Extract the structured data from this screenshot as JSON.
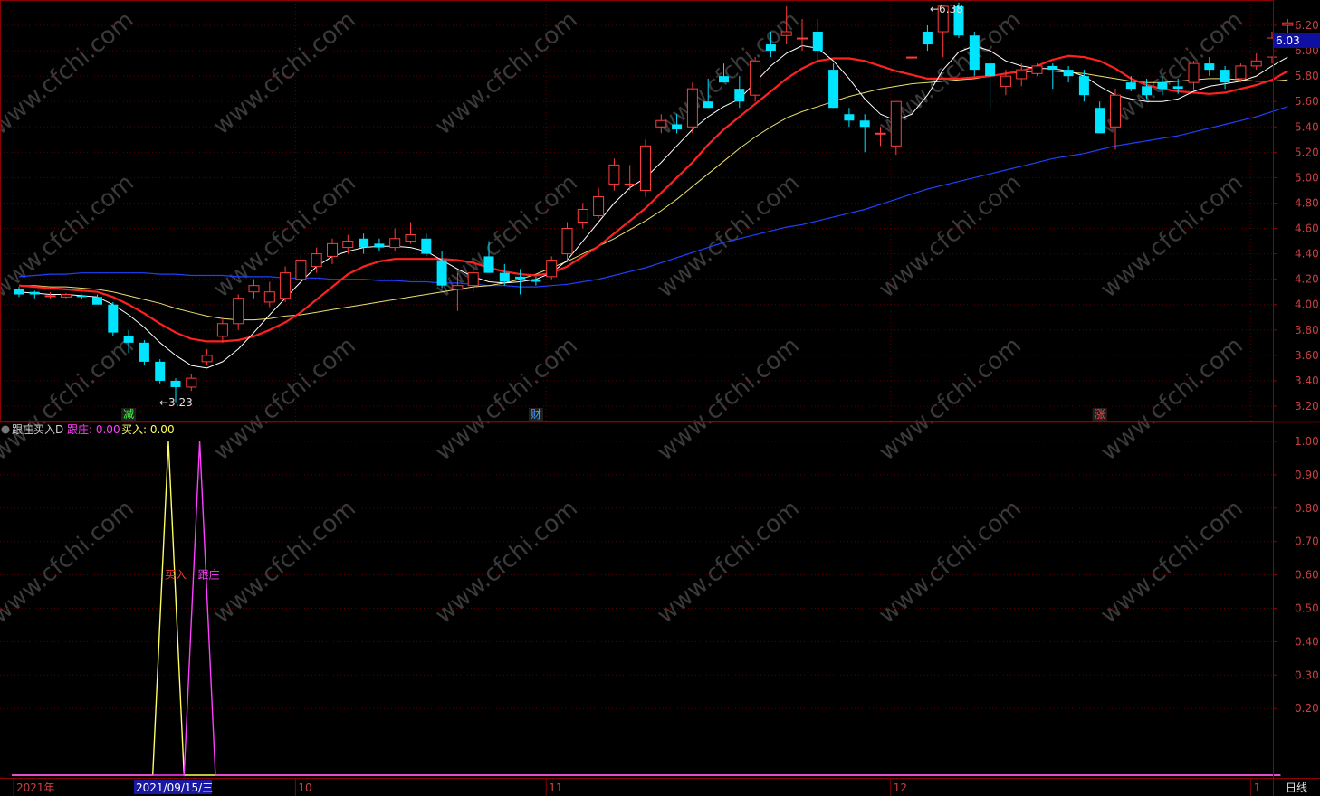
{
  "colors": {
    "background": "#000000",
    "frame": "#8b0000",
    "grid": "#5a0000",
    "axis_text": "#c84040",
    "up": "#ff3c3c",
    "down": "#00e5ff",
    "ma_white": "#ffffff",
    "ma_red": "#ff2020",
    "ma_yellow": "#e8e070",
    "ma_blue": "#2040ff",
    "follow_line": "#ff40ff",
    "buy_line": "#ffff60"
  },
  "watermark": "www.cfchi.com",
  "price_panel": {
    "yticks": [
      "6.20",
      "6.00",
      "5.80",
      "5.60",
      "5.40",
      "5.20",
      "5.00",
      "4.80",
      "4.60",
      "4.40",
      "4.20",
      "4.00",
      "3.80",
      "3.60",
      "3.40",
      "3.20"
    ],
    "current_price": "6.03",
    "high_label": "6.38",
    "low_label": "3.23",
    "high_arrow": "←6.38",
    "low_arrow": "←3.23",
    "markers": [
      {
        "text": "减",
        "color": "#40ff40",
        "bar": 7
      },
      {
        "text": "财",
        "color": "#40a0ff",
        "bar": 33
      },
      {
        "text": "涨",
        "color": "#ff4040",
        "bar": 69
      }
    ],
    "ylim": [
      3.1,
      6.25
    ]
  },
  "indicator_panel": {
    "title": "跟庄买入D",
    "follow_label": "跟庄: 0.00",
    "buy_label": "买入: 0.00",
    "yticks": [
      "1.00",
      "0.90",
      "0.80",
      "0.70",
      "0.60",
      "0.50",
      "0.40",
      "0.30",
      "0.20"
    ],
    "annotation_buy": "买入",
    "annotation_follow": "跟庄",
    "ylim": [
      0,
      1.05
    ]
  },
  "x_axis": {
    "labels": [
      {
        "text": "2021年",
        "bar": 0
      },
      {
        "text": "10",
        "bar": 18
      },
      {
        "text": "11",
        "bar": 34
      },
      {
        "text": "12",
        "bar": 56
      },
      {
        "text": "1",
        "bar": 79
      }
    ],
    "highlight_date": "2021/09/15/三",
    "highlight_bar": 8,
    "period": "日线"
  },
  "chart_data": {
    "type": "candlestick",
    "ohlc": [
      [
        4.12,
        4.14,
        4.06,
        4.08
      ],
      [
        4.1,
        4.11,
        4.05,
        4.08
      ],
      [
        4.07,
        4.1,
        4.05,
        4.07
      ],
      [
        4.06,
        4.09,
        4.05,
        4.08
      ],
      [
        4.07,
        4.08,
        4.04,
        4.06
      ],
      [
        4.06,
        4.08,
        4.01,
        4.0
      ],
      [
        4.0,
        4.02,
        3.75,
        3.78
      ],
      [
        3.75,
        3.8,
        3.62,
        3.7
      ],
      [
        3.7,
        3.72,
        3.52,
        3.55
      ],
      [
        3.55,
        3.57,
        3.38,
        3.4
      ],
      [
        3.4,
        3.42,
        3.23,
        3.35
      ],
      [
        3.35,
        3.45,
        3.32,
        3.42
      ],
      [
        3.55,
        3.65,
        3.52,
        3.6
      ],
      [
        3.75,
        3.9,
        3.7,
        3.85
      ],
      [
        3.85,
        4.08,
        3.8,
        4.05
      ],
      [
        4.1,
        4.2,
        4.05,
        4.15
      ],
      [
        4.02,
        4.18,
        3.98,
        4.1
      ],
      [
        4.05,
        4.3,
        4.02,
        4.25
      ],
      [
        4.2,
        4.4,
        4.15,
        4.35
      ],
      [
        4.3,
        4.45,
        4.25,
        4.4
      ],
      [
        4.38,
        4.52,
        4.32,
        4.48
      ],
      [
        4.45,
        4.55,
        4.4,
        4.5
      ],
      [
        4.52,
        4.56,
        4.4,
        4.45
      ],
      [
        4.48,
        4.52,
        4.42,
        4.45
      ],
      [
        4.45,
        4.6,
        4.42,
        4.52
      ],
      [
        4.5,
        4.65,
        4.48,
        4.55
      ],
      [
        4.52,
        4.56,
        4.38,
        4.4
      ],
      [
        4.35,
        4.42,
        4.13,
        4.15
      ],
      [
        4.12,
        4.25,
        3.95,
        4.15
      ],
      [
        4.15,
        4.32,
        4.1,
        4.25
      ],
      [
        4.38,
        4.5,
        4.28,
        4.25
      ],
      [
        4.25,
        4.32,
        4.15,
        4.18
      ],
      [
        4.22,
        4.28,
        4.08,
        4.2
      ],
      [
        4.2,
        4.22,
        4.15,
        4.18
      ],
      [
        4.22,
        4.38,
        4.2,
        4.35
      ],
      [
        4.4,
        4.65,
        4.35,
        4.6
      ],
      [
        4.65,
        4.8,
        4.6,
        4.75
      ],
      [
        4.7,
        4.92,
        4.68,
        4.85
      ],
      [
        4.95,
        5.15,
        4.9,
        5.1
      ],
      [
        4.95,
        5.1,
        4.9,
        4.95
      ],
      [
        4.9,
        5.3,
        4.85,
        5.25
      ],
      [
        5.4,
        5.5,
        5.35,
        5.45
      ],
      [
        5.42,
        5.5,
        5.35,
        5.38
      ],
      [
        5.4,
        5.75,
        5.35,
        5.7
      ],
      [
        5.6,
        5.78,
        5.55,
        5.55
      ],
      [
        5.8,
        5.9,
        5.75,
        5.75
      ],
      [
        5.7,
        5.8,
        5.55,
        5.6
      ],
      [
        5.65,
        5.95,
        5.6,
        5.92
      ],
      [
        6.05,
        6.15,
        5.95,
        6.0
      ],
      [
        6.12,
        6.35,
        6.05,
        6.15
      ],
      [
        6.1,
        6.25,
        6.0,
        6.1
      ],
      [
        6.15,
        6.25,
        5.9,
        6.0
      ],
      [
        5.85,
        5.9,
        5.55,
        5.55
      ],
      [
        5.5,
        5.55,
        5.4,
        5.45
      ],
      [
        5.45,
        5.5,
        5.2,
        5.4
      ],
      [
        5.35,
        5.4,
        5.25,
        5.35
      ],
      [
        5.25,
        5.6,
        5.18,
        5.6
      ],
      [
        5.95,
        5.95,
        5.95,
        5.95
      ],
      [
        6.15,
        6.2,
        6.0,
        6.05
      ],
      [
        6.15,
        6.35,
        5.95,
        6.35
      ],
      [
        6.35,
        6.38,
        6.1,
        6.12
      ],
      [
        6.12,
        6.15,
        5.8,
        5.85
      ],
      [
        5.9,
        5.95,
        5.55,
        5.8
      ],
      [
        5.72,
        5.85,
        5.65,
        5.8
      ],
      [
        5.78,
        5.9,
        5.72,
        5.85
      ],
      [
        5.82,
        5.9,
        5.8,
        5.88
      ],
      [
        5.88,
        5.9,
        5.7,
        5.85
      ],
      [
        5.85,
        5.88,
        5.75,
        5.8
      ],
      [
        5.8,
        5.85,
        5.6,
        5.65
      ],
      [
        5.55,
        5.6,
        5.35,
        5.35
      ],
      [
        5.4,
        5.7,
        5.22,
        5.65
      ],
      [
        5.75,
        5.8,
        5.68,
        5.7
      ],
      [
        5.72,
        5.78,
        5.62,
        5.65
      ],
      [
        5.75,
        5.8,
        5.65,
        5.7
      ],
      [
        5.72,
        5.78,
        5.66,
        5.7
      ],
      [
        5.75,
        5.92,
        5.68,
        5.9
      ],
      [
        5.9,
        5.95,
        5.8,
        5.85
      ],
      [
        5.85,
        5.88,
        5.7,
        5.75
      ],
      [
        5.78,
        5.9,
        5.75,
        5.88
      ],
      [
        5.88,
        5.98,
        5.85,
        5.92
      ],
      [
        5.95,
        6.15,
        5.9,
        6.1
      ],
      [
        6.2,
        6.25,
        6.08,
        6.22
      ]
    ],
    "ma_white": [
      4.1,
      4.09,
      4.08,
      4.08,
      4.07,
      4.06,
      4.0,
      3.92,
      3.82,
      3.7,
      3.6,
      3.52,
      3.5,
      3.55,
      3.65,
      3.78,
      3.92,
      4.05,
      4.18,
      4.3,
      4.38,
      4.42,
      4.45,
      4.46,
      4.46,
      4.45,
      4.42,
      4.35,
      4.28,
      4.22,
      4.18,
      4.17,
      4.18,
      4.2,
      4.25,
      4.35,
      4.5,
      4.65,
      4.8,
      4.92,
      5.0,
      5.12,
      5.25,
      5.38,
      5.48,
      5.56,
      5.62,
      5.75,
      5.88,
      5.98,
      6.04,
      6.02,
      5.92,
      5.78,
      5.62,
      5.5,
      5.45,
      5.5,
      5.65,
      5.85,
      5.99,
      6.04,
      6.0,
      5.92,
      5.88,
      5.86,
      5.86,
      5.84,
      5.8,
      5.72,
      5.65,
      5.62,
      5.6,
      5.6,
      5.62,
      5.68,
      5.72,
      5.74,
      5.76,
      5.8,
      5.88,
      5.95
    ],
    "ma_red": [
      4.15,
      4.14,
      4.13,
      4.12,
      4.11,
      4.1,
      4.06,
      4.0,
      3.93,
      3.85,
      3.78,
      3.73,
      3.71,
      3.71,
      3.72,
      3.75,
      3.8,
      3.86,
      3.94,
      4.04,
      4.14,
      4.24,
      4.3,
      4.34,
      4.36,
      4.36,
      4.36,
      4.36,
      4.35,
      4.33,
      4.29,
      4.26,
      4.24,
      4.23,
      4.25,
      4.3,
      4.38,
      4.46,
      4.56,
      4.66,
      4.76,
      4.88,
      5.0,
      5.12,
      5.26,
      5.38,
      5.48,
      5.58,
      5.68,
      5.78,
      5.86,
      5.92,
      5.94,
      5.94,
      5.92,
      5.88,
      5.84,
      5.81,
      5.78,
      5.78,
      5.78,
      5.79,
      5.8,
      5.82,
      5.84,
      5.88,
      5.93,
      5.96,
      5.95,
      5.92,
      5.86,
      5.78,
      5.73,
      5.7,
      5.68,
      5.67,
      5.66,
      5.67,
      5.7,
      5.73,
      5.77,
      5.84
    ],
    "ma_yellow": [
      4.15,
      4.15,
      4.14,
      4.14,
      4.13,
      4.12,
      4.1,
      4.07,
      4.04,
      4.01,
      3.97,
      3.94,
      3.91,
      3.89,
      3.88,
      3.88,
      3.89,
      3.91,
      3.92,
      3.94,
      3.96,
      3.98,
      4.0,
      4.02,
      4.04,
      4.06,
      4.08,
      4.1,
      4.12,
      4.14,
      4.15,
      4.17,
      4.2,
      4.24,
      4.29,
      4.34,
      4.4,
      4.46,
      4.52,
      4.59,
      4.66,
      4.74,
      4.83,
      4.93,
      5.03,
      5.13,
      5.23,
      5.32,
      5.4,
      5.47,
      5.52,
      5.56,
      5.6,
      5.64,
      5.67,
      5.7,
      5.72,
      5.74,
      5.75,
      5.76,
      5.77,
      5.78,
      5.8,
      5.82,
      5.83,
      5.84,
      5.84,
      5.83,
      5.82,
      5.8,
      5.78,
      5.76,
      5.75,
      5.75,
      5.76,
      5.77,
      5.78,
      5.78,
      5.77,
      5.76,
      5.76,
      5.77
    ],
    "ma_blue": [
      4.22,
      4.23,
      4.24,
      4.24,
      4.25,
      4.25,
      4.25,
      4.25,
      4.25,
      4.24,
      4.24,
      4.23,
      4.23,
      4.23,
      4.22,
      4.22,
      4.22,
      4.21,
      4.21,
      4.21,
      4.2,
      4.2,
      4.2,
      4.19,
      4.19,
      4.18,
      4.18,
      4.17,
      4.17,
      4.16,
      4.15,
      4.15,
      4.14,
      4.14,
      4.15,
      4.16,
      4.18,
      4.2,
      4.23,
      4.26,
      4.29,
      4.33,
      4.37,
      4.41,
      4.45,
      4.49,
      4.52,
      4.55,
      4.58,
      4.61,
      4.63,
      4.66,
      4.69,
      4.72,
      4.75,
      4.79,
      4.83,
      4.87,
      4.91,
      4.94,
      4.97,
      5.0,
      5.03,
      5.06,
      5.09,
      5.12,
      5.15,
      5.17,
      5.19,
      5.22,
      5.25,
      5.27,
      5.29,
      5.31,
      5.33,
      5.36,
      5.39,
      5.42,
      5.45,
      5.48,
      5.52,
      5.56
    ],
    "indicator_buy": [
      [
        0,
        0
      ],
      [
        9,
        0
      ],
      [
        10,
        1.0
      ],
      [
        11,
        0
      ],
      [
        81,
        0
      ]
    ],
    "indicator_follow": [
      [
        0,
        0
      ],
      [
        11,
        0
      ],
      [
        12,
        1.0
      ],
      [
        13,
        0
      ],
      [
        81,
        0
      ]
    ]
  }
}
